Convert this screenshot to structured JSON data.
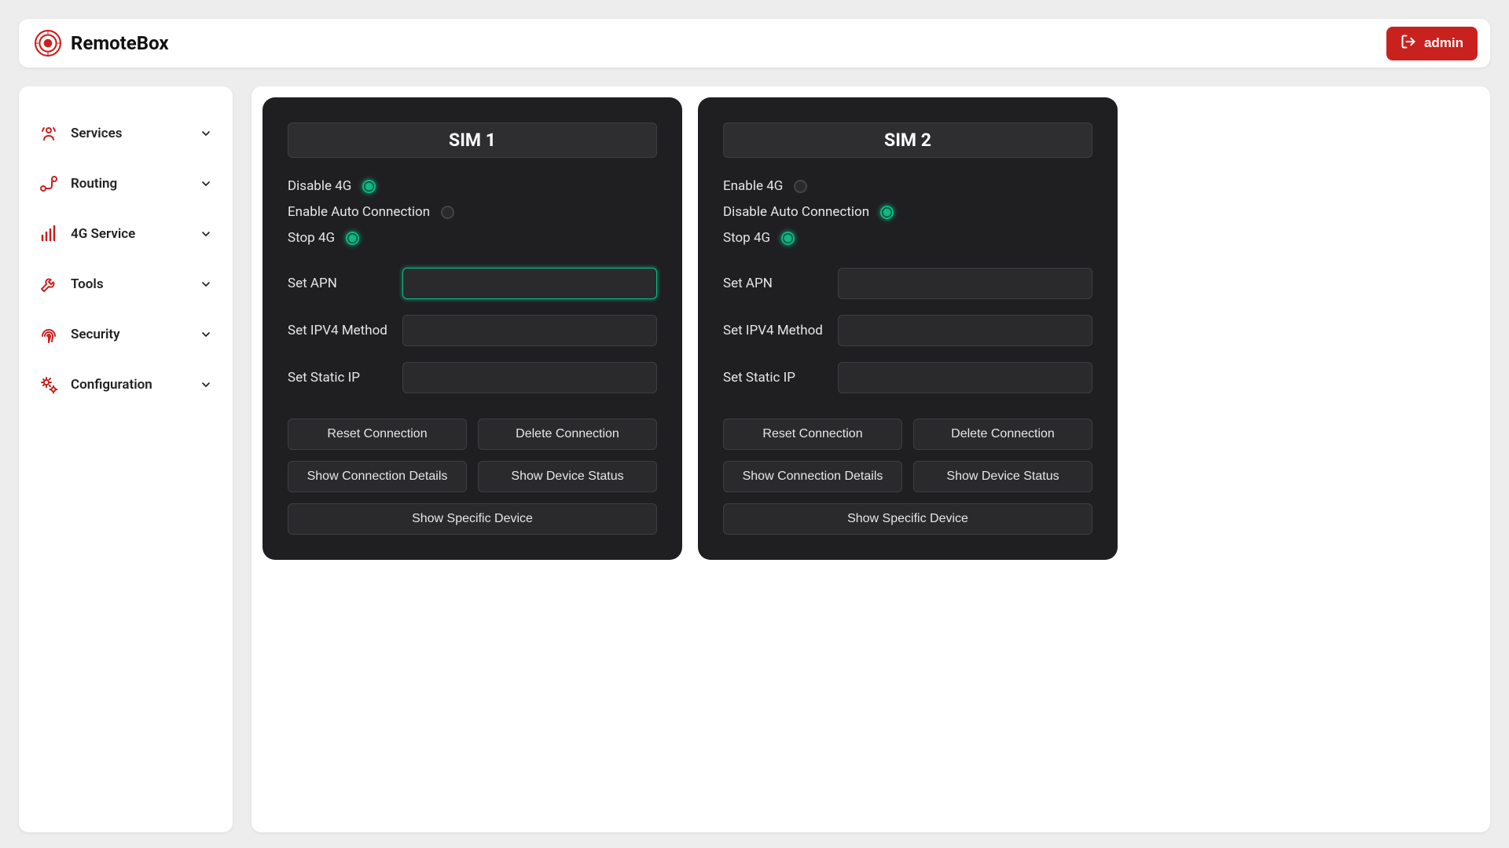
{
  "header": {
    "brand": "RemoteBox",
    "admin_label": "admin"
  },
  "sidebar": {
    "items": [
      {
        "label": "Services"
      },
      {
        "label": "Routing"
      },
      {
        "label": "4G Service"
      },
      {
        "label": "Tools"
      },
      {
        "label": "Security"
      },
      {
        "label": "Configuration"
      }
    ]
  },
  "cards": [
    {
      "title": "SIM 1",
      "toggles": [
        {
          "label": "Disable 4G",
          "on": true
        },
        {
          "label": "Enable Auto Connection",
          "on": false
        },
        {
          "label": "Stop 4G",
          "on": true
        }
      ],
      "fields": {
        "apn": {
          "label": "Set APN",
          "value": "",
          "focused": true
        },
        "ipv4": {
          "label": "Set IPV4 Method",
          "value": ""
        },
        "static_ip": {
          "label": "Set Static IP",
          "value": ""
        }
      },
      "buttons": {
        "reset": "Reset Connection",
        "delete": "Delete Connection",
        "details": "Show Connection Details",
        "status": "Show Device Status",
        "specific": "Show Specific Device"
      }
    },
    {
      "title": "SIM 2",
      "toggles": [
        {
          "label": "Enable 4G",
          "on": false
        },
        {
          "label": "Disable Auto Connection",
          "on": true
        },
        {
          "label": "Stop 4G",
          "on": true
        }
      ],
      "fields": {
        "apn": {
          "label": "Set APN",
          "value": "",
          "focused": false
        },
        "ipv4": {
          "label": "Set IPV4 Method",
          "value": ""
        },
        "static_ip": {
          "label": "Set Static IP",
          "value": ""
        }
      },
      "buttons": {
        "reset": "Reset Connection",
        "delete": "Delete Connection",
        "details": "Show Connection Details",
        "status": "Show Device Status",
        "specific": "Show Specific Device"
      }
    }
  ]
}
